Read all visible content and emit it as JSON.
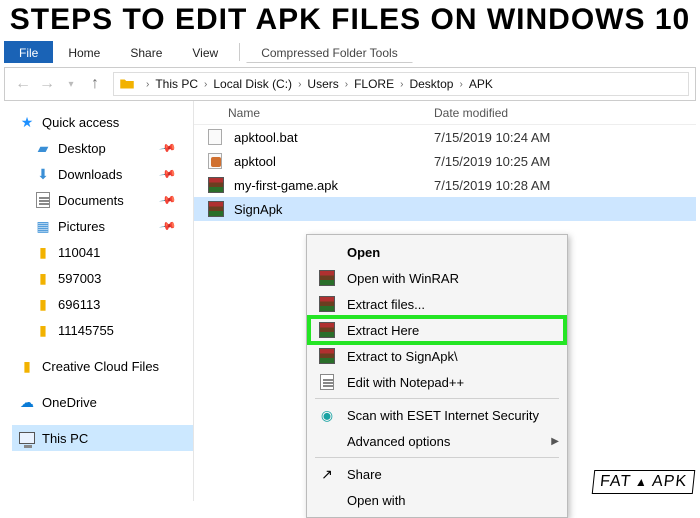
{
  "headline": "STEPS TO EDIT APK FILES ON WINDOWS 10",
  "tabs": [
    "File",
    "Home",
    "Share",
    "View"
  ],
  "tool_tab": "Compressed Folder Tools",
  "breadcrumbs": [
    "This PC",
    "Local Disk (C:)",
    "Users",
    "FLORE",
    "Desktop",
    "APK"
  ],
  "columns": {
    "name": "Name",
    "date": "Date modified"
  },
  "sidebar": {
    "quick": "Quick access",
    "items": [
      "Desktop",
      "Downloads",
      "Documents",
      "Pictures",
      "110041",
      "597003",
      "696113",
      "11145755"
    ],
    "creative": "Creative Cloud Files",
    "onedrive": "OneDrive",
    "thispc": "This PC"
  },
  "files": [
    {
      "name": "apktool.bat",
      "date": "7/15/2019 10:24 AM",
      "type": "bat"
    },
    {
      "name": "apktool",
      "date": "7/15/2019 10:25 AM",
      "type": "jar"
    },
    {
      "name": "my-first-game.apk",
      "date": "7/15/2019 10:28 AM",
      "type": "rar"
    },
    {
      "name": "SignApk",
      "date": "",
      "type": "rar",
      "selected": true
    }
  ],
  "context_menu": [
    {
      "label": "Open",
      "bold": true
    },
    {
      "label": "Open with WinRAR",
      "icon": "rar"
    },
    {
      "label": "Extract files...",
      "icon": "rar"
    },
    {
      "label": "Extract Here",
      "icon": "rar",
      "highlight": true
    },
    {
      "label": "Extract to SignApk\\",
      "icon": "rar"
    },
    {
      "label": "Edit with Notepad++",
      "icon": "doc"
    },
    {
      "sep": true
    },
    {
      "label": "Scan with ESET Internet Security",
      "icon": "eset"
    },
    {
      "label": "Advanced options",
      "arrow": true
    },
    {
      "sep": true
    },
    {
      "label": "Share",
      "icon": "share"
    },
    {
      "label": "Open with"
    }
  ],
  "watermark": {
    "a": "FAT",
    "b": "APK"
  }
}
